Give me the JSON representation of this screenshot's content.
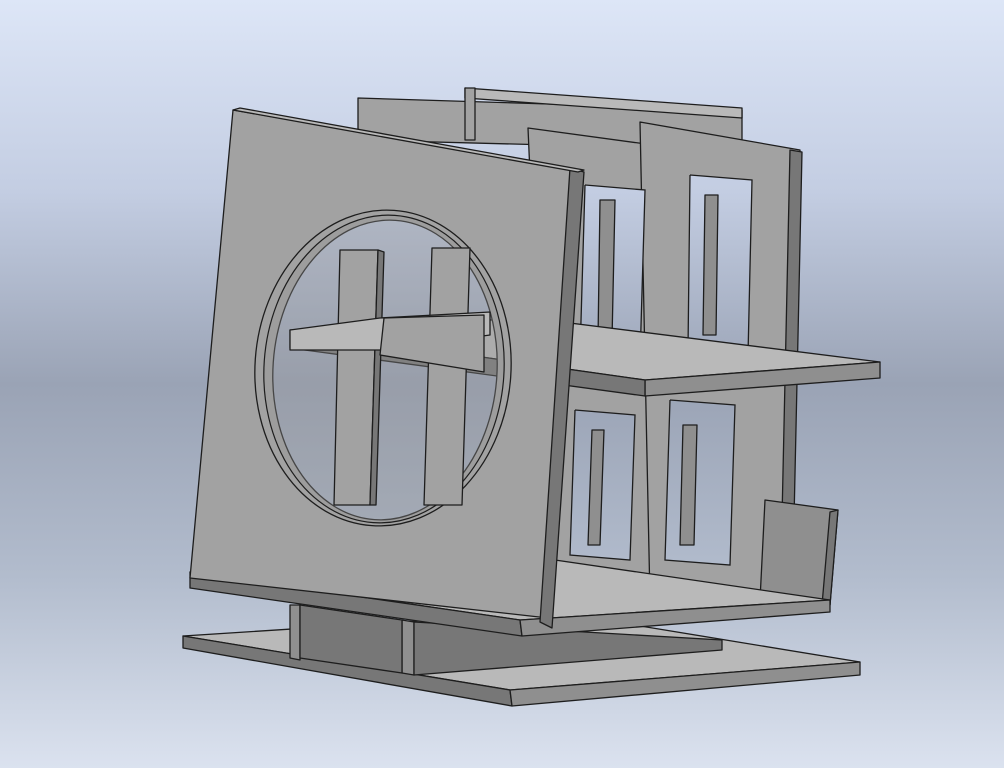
{
  "viewport": {
    "background_top": "#dde6f7",
    "background_mid": "#9aa3b5",
    "model_color": "#a2a2a2",
    "edge_color": "#1d1d1d"
  }
}
